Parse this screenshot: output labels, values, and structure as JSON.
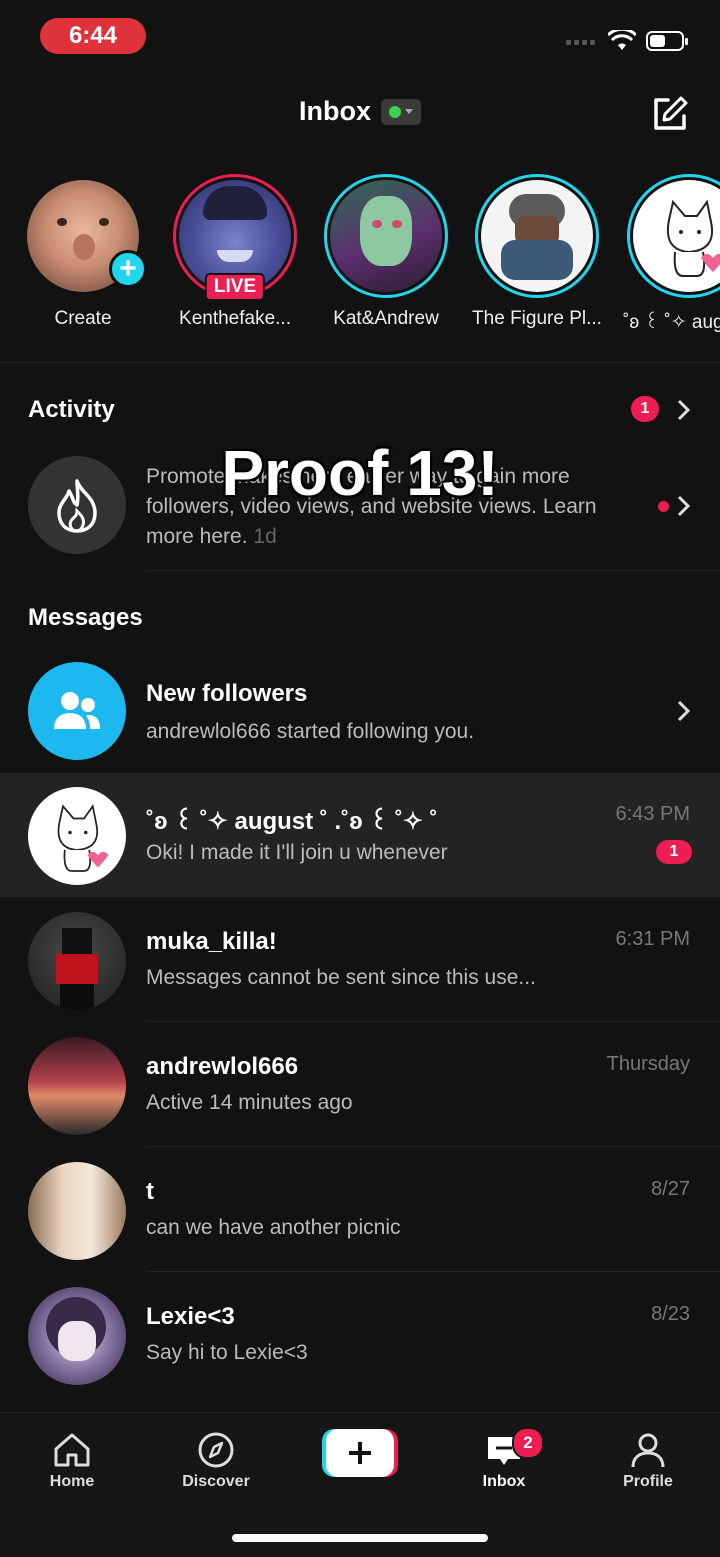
{
  "status_bar": {
    "time": "6:44",
    "battery_level": 0.5
  },
  "header": {
    "title": "Inbox"
  },
  "stories": [
    {
      "name": "Create"
    },
    {
      "name": "Kenthefake...",
      "live_label": "LIVE"
    },
    {
      "name": "Kat&Andrew"
    },
    {
      "name": "The Figure Pl..."
    },
    {
      "name": "˚ʚ ꒰ ˚✧ aug"
    }
  ],
  "activity": {
    "title": "Activity",
    "count": "1",
    "item": {
      "preview": "Promote makes here easier way to gain more followers, video views, and website views. Learn more here.",
      "ts": "1d"
    }
  },
  "overlay_text": "Proof 13!",
  "messages_title": "Messages",
  "new_followers": {
    "title": "New followers",
    "subtitle": "andrewlol666 started following you."
  },
  "messages": [
    {
      "name": "˚ʚ ꒰ ˚✧ august ˚ .˚ʚ ꒰ ˚✧ ˚",
      "preview": "Oki! I made it I'll join u whenever",
      "time": "6:43 PM",
      "unread": "1"
    },
    {
      "name": "muka_killa!",
      "preview": "Messages cannot be sent since this use...",
      "time": "6:31 PM"
    },
    {
      "name": "andrewlol666",
      "preview": "Active 14 minutes ago",
      "time": "Thursday"
    },
    {
      "name": "t",
      "preview": "can we have another picnic",
      "time": "8/27"
    },
    {
      "name": "Lexie<3",
      "preview": "Say hi to Lexie<3",
      "time": "8/23"
    }
  ],
  "bottom_nav": {
    "home": "Home",
    "discover": "Discover",
    "inbox": "Inbox",
    "inbox_badge": "2",
    "profile": "Profile"
  },
  "colors": {
    "accent_red": "#ee1d52",
    "accent_cyan": "#20d5ec",
    "follower_blue": "#1eb8f0"
  }
}
